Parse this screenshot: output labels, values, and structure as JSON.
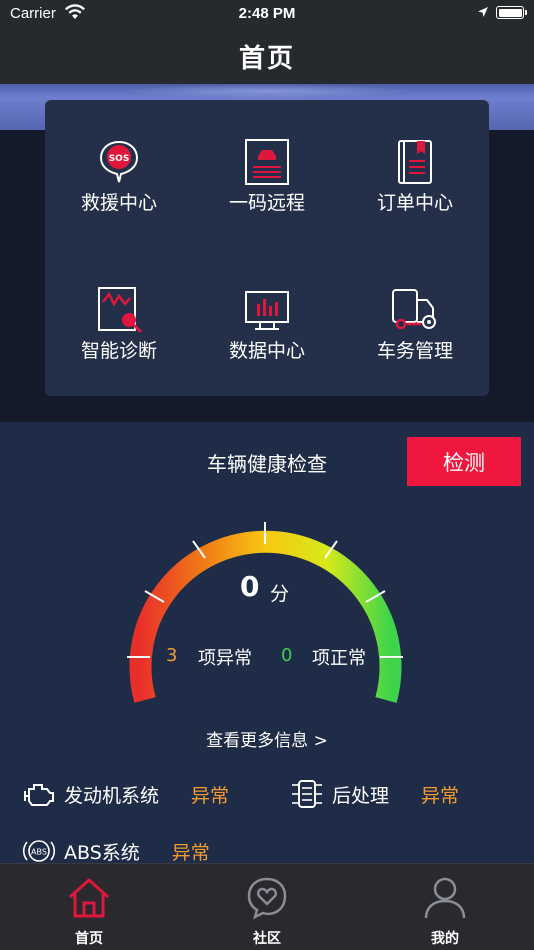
{
  "status_bar": {
    "carrier": "Carrier",
    "time": "2:48 PM"
  },
  "nav": {
    "title": "首页"
  },
  "menu": {
    "items": [
      {
        "label": "救援中心",
        "icon": "sos-icon"
      },
      {
        "label": "一码远程",
        "icon": "remote-code-icon"
      },
      {
        "label": "订单中心",
        "icon": "order-book-icon"
      },
      {
        "label": "智能诊断",
        "icon": "diagnosis-icon"
      },
      {
        "label": "数据中心",
        "icon": "data-center-icon"
      },
      {
        "label": "车务管理",
        "icon": "truck-manage-icon"
      }
    ]
  },
  "health": {
    "title": "车辆健康检查",
    "detect_label": "检测",
    "score": "0",
    "score_unit": "分",
    "abnormal_count": "3",
    "abnormal_label": "项异常",
    "normal_count": "0",
    "normal_label": "项正常",
    "more_link": "查看更多信息 >"
  },
  "systems": [
    {
      "name": "发动机系统",
      "status": "异常",
      "icon": "engine-icon"
    },
    {
      "name": "后处理",
      "status": "异常",
      "icon": "after-treatment-icon"
    },
    {
      "name": "ABS系统",
      "status": "异常",
      "icon": "abs-icon"
    }
  ],
  "tabbar": {
    "items": [
      {
        "label": "首页",
        "icon": "home-icon",
        "active": true
      },
      {
        "label": "社区",
        "icon": "community-heart-icon",
        "active": false
      },
      {
        "label": "我的",
        "icon": "profile-icon",
        "active": false
      }
    ]
  },
  "colors": {
    "accent": "#f0173f",
    "warning": "#f19a32",
    "ok": "#3fcc4f",
    "background": "#1f2c47",
    "card": "#243049"
  }
}
